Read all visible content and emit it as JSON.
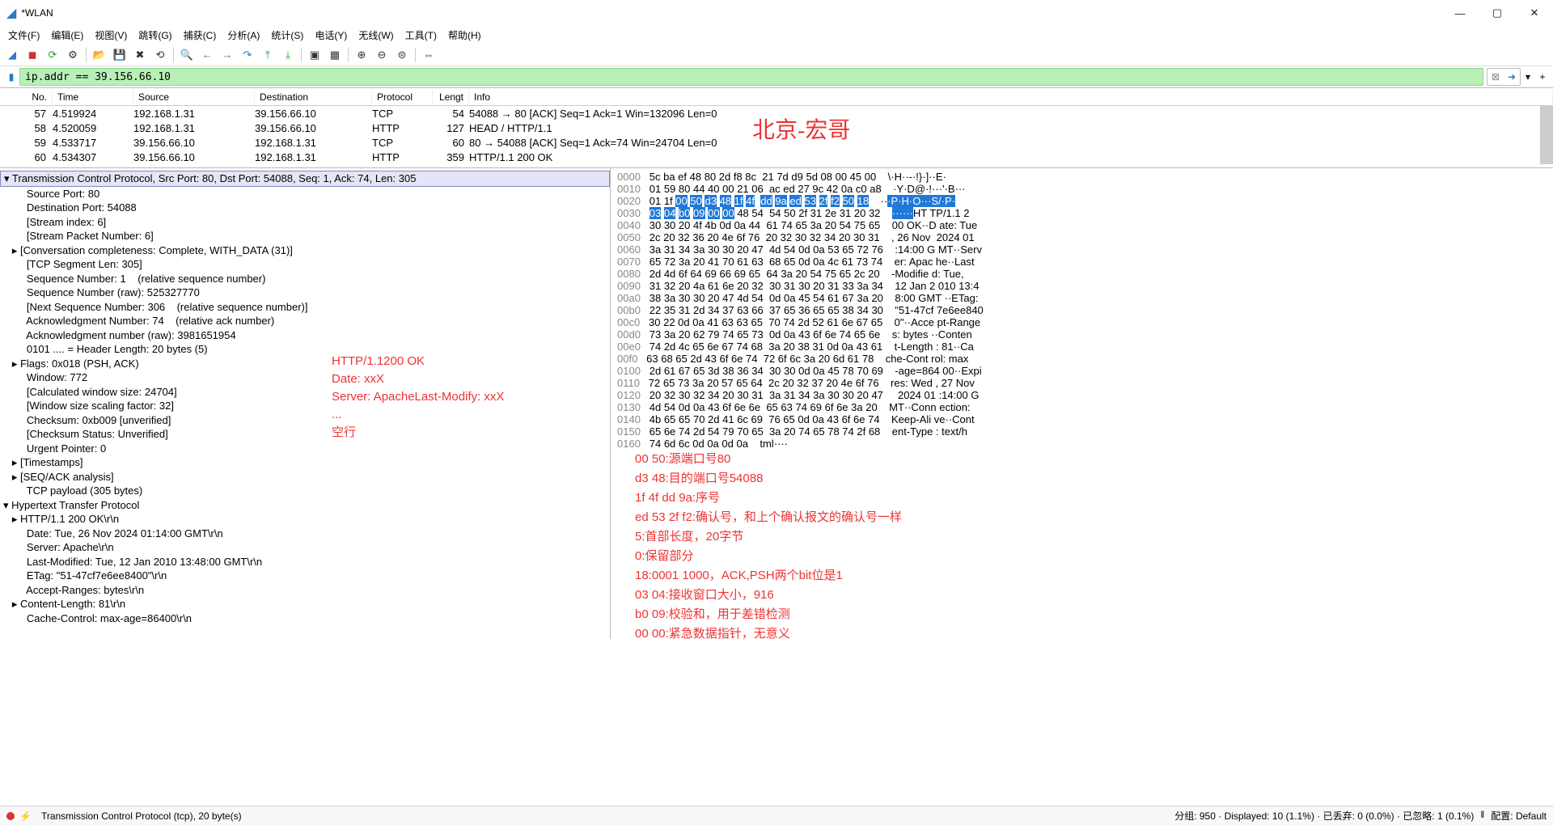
{
  "window": {
    "title": "*WLAN"
  },
  "menu": [
    "文件(F)",
    "编辑(E)",
    "视图(V)",
    "跳转(G)",
    "捕获(C)",
    "分析(A)",
    "统计(S)",
    "电话(Y)",
    "无线(W)",
    "工具(T)",
    "帮助(H)"
  ],
  "filter": "ip.addr == 39.156.66.10",
  "watermark": "北京-宏哥",
  "columns": {
    "no": "No.",
    "time": "Time",
    "src": "Source",
    "dst": "Destination",
    "proto": "Protocol",
    "len": "Lengt",
    "info": "Info"
  },
  "packets": [
    {
      "no": "57",
      "time": "4.519924",
      "src": "192.168.1.31",
      "dst": "39.156.66.10",
      "proto": "TCP",
      "len": "54",
      "info": "54088 → 80 [ACK] Seq=1 Ack=1 Win=132096 Len=0"
    },
    {
      "no": "58",
      "time": "4.520059",
      "src": "192.168.1.31",
      "dst": "39.156.66.10",
      "proto": "HTTP",
      "len": "127",
      "info": "HEAD / HTTP/1.1"
    },
    {
      "no": "59",
      "time": "4.533717",
      "src": "39.156.66.10",
      "dst": "192.168.1.31",
      "proto": "TCP",
      "len": "60",
      "info": "80 → 54088 [ACK] Seq=1 Ack=74 Win=24704 Len=0"
    },
    {
      "no": "60",
      "time": "4.534307",
      "src": "39.156.66.10",
      "dst": "192.168.1.31",
      "proto": "HTTP",
      "len": "359",
      "info": "HTTP/1.1 200 OK"
    }
  ],
  "detail_root": "Transmission Control Protocol, Src Port: 80, Dst Port: 54088, Seq: 1, Ack: 74, Len: 305",
  "detail": [
    {
      "i": 2,
      "e": "",
      "t": "Source Port: 80"
    },
    {
      "i": 2,
      "e": "",
      "t": "Destination Port: 54088"
    },
    {
      "i": 2,
      "e": "",
      "t": "[Stream index: 6]"
    },
    {
      "i": 2,
      "e": "",
      "t": "[Stream Packet Number: 6]"
    },
    {
      "i": 1,
      "e": ">",
      "t": "[Conversation completeness: Complete, WITH_DATA (31)]"
    },
    {
      "i": 2,
      "e": "",
      "t": "[TCP Segment Len: 305]"
    },
    {
      "i": 2,
      "e": "",
      "t": "Sequence Number: 1    (relative sequence number)"
    },
    {
      "i": 2,
      "e": "",
      "t": "Sequence Number (raw): 525327770"
    },
    {
      "i": 2,
      "e": "",
      "t": "[Next Sequence Number: 306    (relative sequence number)]"
    },
    {
      "i": 2,
      "e": "",
      "t": "Acknowledgment Number: 74    (relative ack number)"
    },
    {
      "i": 2,
      "e": "",
      "t": "Acknowledgment number (raw): 3981651954"
    },
    {
      "i": 2,
      "e": "",
      "t": "0101 .... = Header Length: 20 bytes (5)"
    },
    {
      "i": 1,
      "e": ">",
      "t": "Flags: 0x018 (PSH, ACK)"
    },
    {
      "i": 2,
      "e": "",
      "t": "Window: 772"
    },
    {
      "i": 2,
      "e": "",
      "t": "[Calculated window size: 24704]"
    },
    {
      "i": 2,
      "e": "",
      "t": "[Window size scaling factor: 32]"
    },
    {
      "i": 2,
      "e": "",
      "t": "Checksum: 0xb009 [unverified]"
    },
    {
      "i": 2,
      "e": "",
      "t": "[Checksum Status: Unverified]"
    },
    {
      "i": 2,
      "e": "",
      "t": "Urgent Pointer: 0"
    },
    {
      "i": 1,
      "e": ">",
      "t": "[Timestamps]"
    },
    {
      "i": 1,
      "e": ">",
      "t": "[SEQ/ACK analysis]"
    },
    {
      "i": 2,
      "e": "",
      "t": "TCP payload (305 bytes)"
    }
  ],
  "http_root": "Hypertext Transfer Protocol",
  "http": [
    {
      "i": 1,
      "e": ">",
      "t": "HTTP/1.1 200 OK\\r\\n"
    },
    {
      "i": 2,
      "e": "",
      "t": "Date: Tue, 26 Nov 2024 01:14:00 GMT\\r\\n"
    },
    {
      "i": 2,
      "e": "",
      "t": "Server: Apache\\r\\n"
    },
    {
      "i": 2,
      "e": "",
      "t": "Last-Modified: Tue, 12 Jan 2010 13:48:00 GMT\\r\\n"
    },
    {
      "i": 2,
      "e": "",
      "t": "ETag: \"51-47cf7e6ee8400\"\\r\\n"
    },
    {
      "i": 2,
      "e": "",
      "t": "Accept-Ranges: bytes\\r\\n"
    },
    {
      "i": 1,
      "e": ">",
      "t": "Content-Length: 81\\r\\n"
    },
    {
      "i": 2,
      "e": "",
      "t": "Cache-Control: max-age=86400\\r\\n"
    }
  ],
  "red_detail": [
    "HTTP/1.1200 OK",
    "Date: xxX",
    "Server: ApacheLast-Modify: xxX",
    "...",
    "空行"
  ],
  "hex": [
    {
      "o": "0000",
      "h": "5c ba ef 48 80 2d f8 8c  21 7d d9 5d 08 00 45 00",
      "a": "\\·H··-·!}·]··E·"
    },
    {
      "o": "0010",
      "h": "01 59 80 44 40 00 21 06  ac ed 27 9c 42 0a c0 a8",
      "a": "·Y·D@·!···'·B···"
    },
    {
      "o": "0020",
      "h": "01 1f 00 50 d3 48 1f 4f  dd 9a ed 53 2f f2 50 18",
      "a": "···P·H·O···S/·P·",
      "hs": 2,
      "he": 16
    },
    {
      "o": "0030",
      "h": "03 04 b0 09 00 00 48 54  54 50 2f 31 2e 31 20 32",
      "a": "······HT TP/1.1 2",
      "hs": 0,
      "he": 6
    },
    {
      "o": "0040",
      "h": "30 30 20 4f 4b 0d 0a 44  61 74 65 3a 20 54 75 65",
      "a": "00 OK··D ate: Tue"
    },
    {
      "o": "0050",
      "h": "2c 20 32 36 20 4e 6f 76  20 32 30 32 34 20 30 31",
      "a": ", 26 Nov  2024 01"
    },
    {
      "o": "0060",
      "h": "3a 31 34 3a 30 30 20 47  4d 54 0d 0a 53 65 72 76",
      "a": ":14:00 G MT··Serv"
    },
    {
      "o": "0070",
      "h": "65 72 3a 20 41 70 61 63  68 65 0d 0a 4c 61 73 74",
      "a": "er: Apac he··Last"
    },
    {
      "o": "0080",
      "h": "2d 4d 6f 64 69 66 69 65  64 3a 20 54 75 65 2c 20",
      "a": "-Modifie d: Tue, "
    },
    {
      "o": "0090",
      "h": "31 32 20 4a 61 6e 20 32  30 31 30 20 31 33 3a 34",
      "a": "12 Jan 2 010 13:4"
    },
    {
      "o": "00a0",
      "h": "38 3a 30 30 20 47 4d 54  0d 0a 45 54 61 67 3a 20",
      "a": "8:00 GMT ··ETag: "
    },
    {
      "o": "00b0",
      "h": "22 35 31 2d 34 37 63 66  37 65 36 65 65 38 34 30",
      "a": "\"51-47cf 7e6ee840"
    },
    {
      "o": "00c0",
      "h": "30 22 0d 0a 41 63 63 65  70 74 2d 52 61 6e 67 65",
      "a": "0\"··Acce pt-Range"
    },
    {
      "o": "00d0",
      "h": "73 3a 20 62 79 74 65 73  0d 0a 43 6f 6e 74 65 6e",
      "a": "s: bytes ··Conten"
    },
    {
      "o": "00e0",
      "h": "74 2d 4c 65 6e 67 74 68  3a 20 38 31 0d 0a 43 61",
      "a": "t-Length : 81··Ca"
    },
    {
      "o": "00f0",
      "h": "63 68 65 2d 43 6f 6e 74  72 6f 6c 3a 20 6d 61 78",
      "a": "che-Cont rol: max"
    },
    {
      "o": "0100",
      "h": "2d 61 67 65 3d 38 36 34  30 30 0d 0a 45 78 70 69",
      "a": "-age=864 00··Expi"
    },
    {
      "o": "0110",
      "h": "72 65 73 3a 20 57 65 64  2c 20 32 37 20 4e 6f 76",
      "a": "res: Wed , 27 Nov"
    },
    {
      "o": "0120",
      "h": "20 32 30 32 34 20 30 31  3a 31 34 3a 30 30 20 47",
      "a": " 2024 01 :14:00 G"
    },
    {
      "o": "0130",
      "h": "4d 54 0d 0a 43 6f 6e 6e  65 63 74 69 6f 6e 3a 20",
      "a": "MT··Conn ection: "
    },
    {
      "o": "0140",
      "h": "4b 65 65 70 2d 41 6c 69  76 65 0d 0a 43 6f 6e 74",
      "a": "Keep-Ali ve··Cont"
    },
    {
      "o": "0150",
      "h": "65 6e 74 2d 54 79 70 65  3a 20 74 65 78 74 2f 68",
      "a": "ent-Type : text/h"
    },
    {
      "o": "0160",
      "h": "74 6d 6c 0d 0a 0d 0a",
      "a": "tml····"
    }
  ],
  "hex_ann": [
    "00 50:源端口号80",
    "d3 48:目的端口号54088",
    "1f 4f dd 9a:序号",
    "ed 53 2f f2:确认号，和上个确认报文的确认号一样",
    "5:首部长度，20字节",
    "0:保留部分",
    "18:0001 1000，ACK,PSH两个bit位是1",
    "03 04:接收窗口大小，916",
    "b0 09:校验和，用于差错检测",
    "00 00:紧急数据指针，无意义"
  ],
  "status": {
    "left": "Transmission Control Protocol (tcp), 20 byte(s)",
    "right": "分组: 950 · Displayed: 10 (1.1%) · 已丢弃: 0 (0.0%) · 已忽略: 1 (0.1%)",
    "profile": "配置: Default"
  }
}
